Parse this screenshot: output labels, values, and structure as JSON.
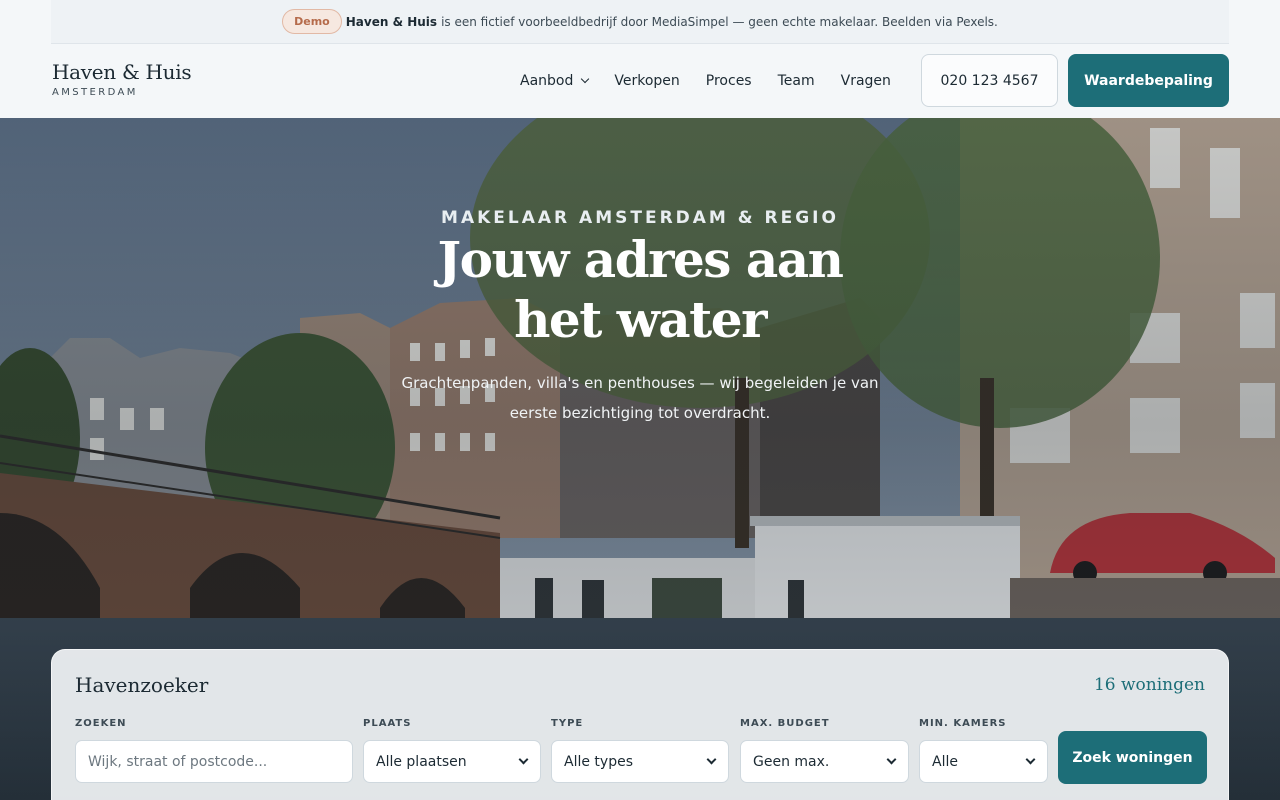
{
  "demo_bar": {
    "badge": "Demo",
    "strong": "Haven & Huis",
    "text": "is een fictief voorbeeldbedrijf door MediaSimpel — geen echte makelaar. Beelden via Pexels."
  },
  "brand": {
    "name": "Haven & Huis",
    "sub": "AMSTERDAM"
  },
  "nav": {
    "items": [
      {
        "label": "Aanbod"
      },
      {
        "label": "Verkopen"
      },
      {
        "label": "Proces"
      },
      {
        "label": "Team"
      },
      {
        "label": "Vragen"
      }
    ],
    "phone": "020 123 4567",
    "cta": "Waardebepaling"
  },
  "hero": {
    "eyebrow": "MAKELAAR AMSTERDAM & REGIO",
    "title": "Jouw adres aan het water",
    "subtitle": "Grachtenpanden, villa's en penthouses — wij begeleiden je van eerste bezichtiging tot overdracht."
  },
  "search": {
    "title": "Havenzoeker",
    "count": "16 woningen",
    "fields": {
      "query": {
        "label": "ZOEKEN",
        "placeholder": "Wijk, straat of postcode..."
      },
      "place": {
        "label": "PLAATS",
        "value": "Alle plaatsen"
      },
      "type": {
        "label": "TYPE",
        "value": "Alle types"
      },
      "budget": {
        "label": "MAX. BUDGET",
        "value": "Geen max."
      },
      "rooms": {
        "label": "MIN. KAMERS",
        "value": "Alle"
      }
    },
    "submit": "Zoek woningen"
  },
  "colors": {
    "accent": "#1d6e78",
    "demo_badge": "#b56b4b",
    "background": "#f4f7f9"
  }
}
